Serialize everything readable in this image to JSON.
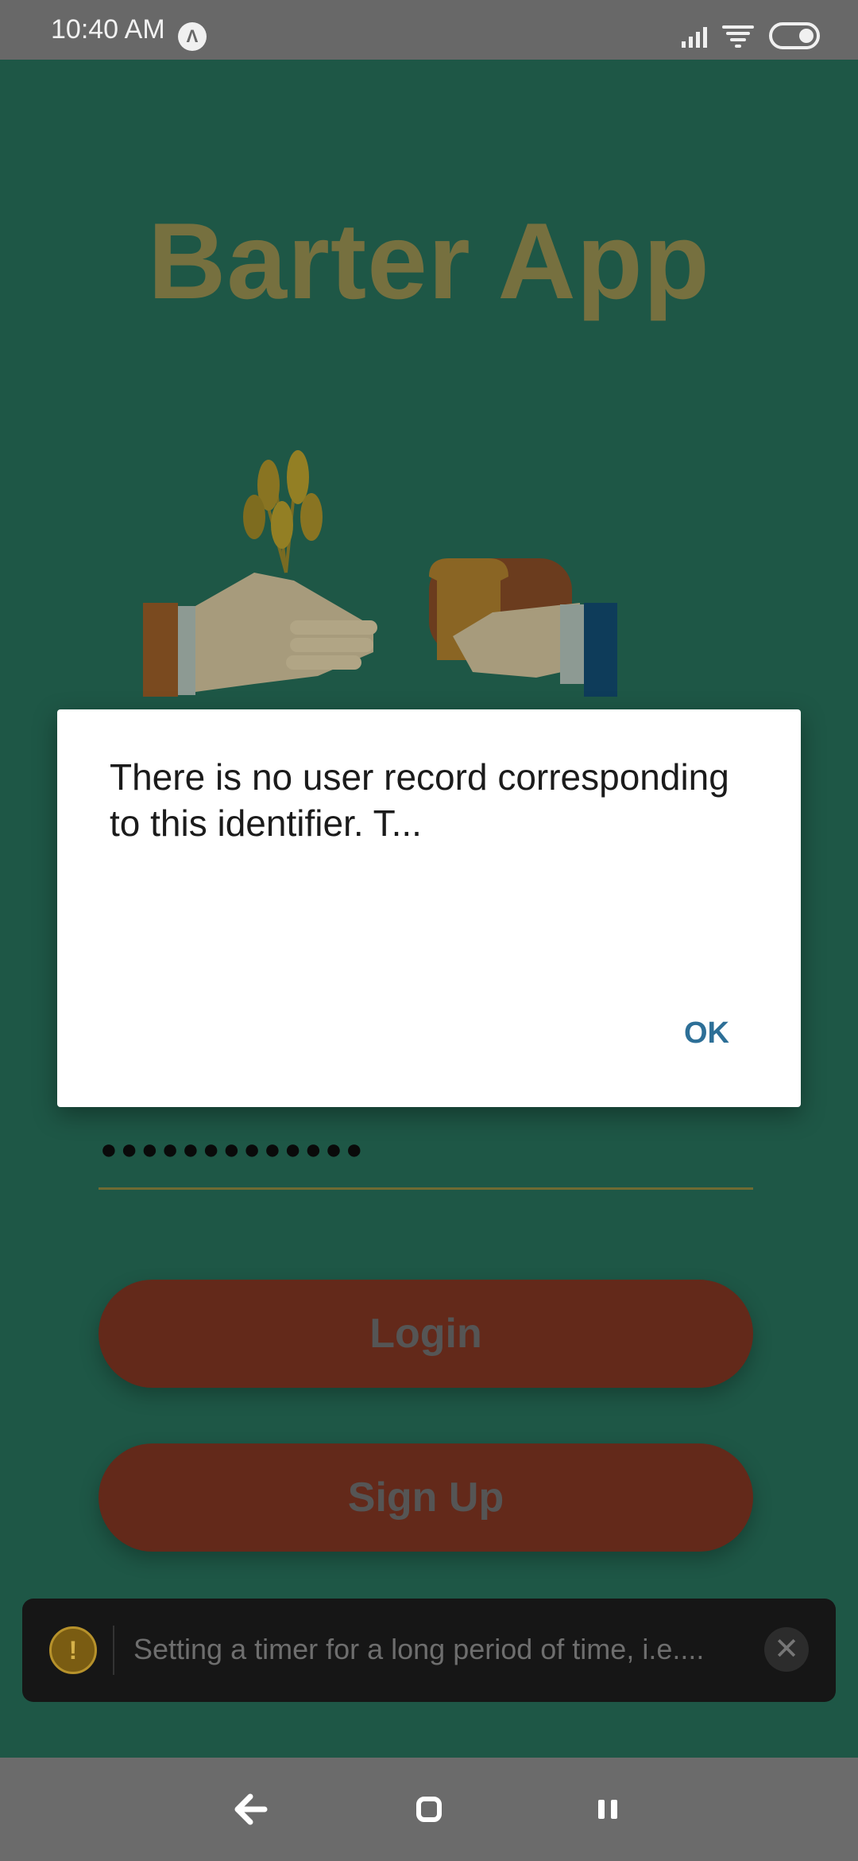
{
  "status_bar": {
    "time": "10:40 AM",
    "app_icon_glyph": "Λ",
    "icons": [
      "signal-icon",
      "wifi-icon",
      "toggle-icon"
    ]
  },
  "app": {
    "title": "Barter App",
    "password_dots": "●●●●●●●●●●●●●",
    "login_label": "Login",
    "signup_label": "Sign Up"
  },
  "dialog": {
    "message": "There is no user record corresponding to this identifier. T...",
    "ok_label": "OK"
  },
  "toast": {
    "warn_glyph": "!",
    "text": "Setting a timer for a long period of time, i.e....",
    "close_glyph": "✕"
  },
  "nav_bar": {
    "icons": [
      "back-icon",
      "home-icon",
      "recents-icon"
    ]
  },
  "colors": {
    "background": "#1e5746",
    "title": "#76703f",
    "button": "#63291a",
    "dialog_accent": "#2d6f97"
  }
}
